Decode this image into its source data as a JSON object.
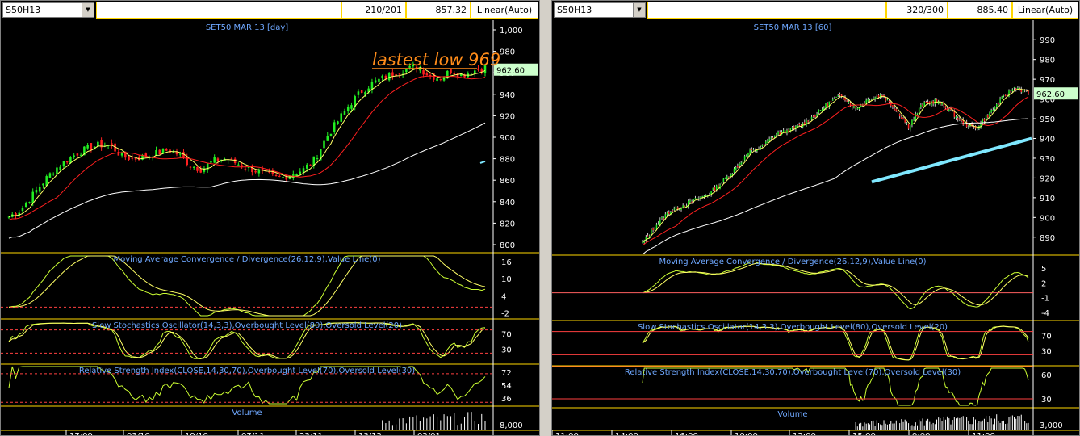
{
  "left": {
    "symbol": "S50H13",
    "counter": "210/201",
    "cursor_value": "857.32",
    "scale_mode": "Linear(Auto)",
    "chart_title": "SET50 MAR 13   [day]",
    "annotation": "lastest low 969",
    "price_badge": "962.60",
    "colors": {
      "annotation": "#ff8c1a"
    },
    "indicator_titles": {
      "macd": "Moving Average Convergence / Divergence(26,12,9),Value Line(0)",
      "stoch": "Slow Stochastics Oscillator(14,3,3),Overbought Level(80),Oversold Level(20)",
      "rsi": "Relative Strength Index(CLOSE,14,30,70),Overbought Level(70),Oversold Level(30)",
      "volume": "Volume"
    },
    "ticks": {
      "price": [
        "1,000",
        "980",
        "960",
        "940",
        "920",
        "900",
        "880",
        "860",
        "840",
        "820",
        "800"
      ],
      "macd": [
        "16",
        "10",
        "4",
        "-2"
      ],
      "stoch": [
        "70",
        "30"
      ],
      "rsi": [
        "72",
        "54",
        "36"
      ],
      "volume": [
        "8,000"
      ],
      "dates": [
        "17/09",
        "03/10",
        "19/10",
        "07/11",
        "23/11",
        "13/12",
        "02/01"
      ]
    }
  },
  "right": {
    "symbol": "S50H13",
    "counter": "320/300",
    "cursor_value": "885.40",
    "scale_mode": "Linear(Auto)",
    "chart_title": "SET50 MAR 13   [60]",
    "price_badge": "962.60",
    "indicator_titles": {
      "macd": "Moving Average Convergence / Divergence(26,12,9),Value Line(0)",
      "stoch": "Slow Stochastics Oscillator(14,3,3),Overbought Level(80),Oversold Level(20)",
      "rsi": "Relative Strength Index(CLOSE,14,30,70),Overbought Level(70),Oversold Level(30)",
      "volume": "Volume"
    },
    "ticks": {
      "price": [
        "990",
        "980",
        "970",
        "960",
        "950",
        "940",
        "930",
        "920",
        "910",
        "900",
        "890"
      ],
      "macd": [
        "5",
        "2",
        "-1",
        "-4"
      ],
      "stoch": [
        "70",
        "30"
      ],
      "rsi": [
        "60",
        "30"
      ],
      "volume": [
        "3,000"
      ],
      "dates": [
        "11:00",
        "14:00",
        "16:00",
        "10:00",
        "12:00",
        "15:00",
        "9:00",
        "11:00"
      ]
    }
  },
  "chart_data": [
    {
      "type": "candlestick",
      "title": "SET50 MAR 13   [day]",
      "ylim": [
        800,
        1000
      ],
      "x": [
        "17/09",
        "03/10",
        "19/10",
        "07/11",
        "23/11",
        "13/12",
        "02/01"
      ],
      "close_path": [
        826,
        832,
        845,
        858,
        870,
        878,
        885,
        890,
        893,
        892,
        882,
        880,
        882,
        885,
        888,
        884,
        874,
        870,
        878,
        880,
        876,
        872,
        868,
        864,
        862,
        866,
        870,
        880,
        900,
        915,
        930,
        942,
        950,
        955,
        960,
        963,
        966,
        958,
        955,
        962,
        958,
        962,
        965
      ],
      "series": [
        {
          "name": "MA fast",
          "color": "#ffff66"
        },
        {
          "name": "MA mid",
          "color": "#ff2020"
        },
        {
          "name": "MA slow",
          "color": "#ffffff"
        }
      ],
      "last": 962.6
    },
    {
      "type": "candlestick",
      "title": "SET50 MAR 13   [60]",
      "ylim": [
        885,
        995
      ],
      "x": [
        "11:00",
        "14:00",
        "16:00",
        "10:00",
        "12:00",
        "15:00",
        "9:00",
        "11:00"
      ],
      "close_path": [
        887,
        896,
        903,
        906,
        909,
        912,
        918,
        925,
        933,
        936,
        942,
        944,
        947,
        952,
        958,
        962,
        955,
        960,
        962,
        955,
        946,
        957,
        959,
        955,
        948,
        945,
        952,
        960,
        966,
        963
      ],
      "series": [
        {
          "name": "MA fast",
          "color": "#ffff66"
        },
        {
          "name": "MA mid",
          "color": "#ff2020"
        },
        {
          "name": "MA slow",
          "color": "#ffffff"
        },
        {
          "name": "trend",
          "color": "#7fe8ff"
        }
      ],
      "last": 962.6
    }
  ]
}
